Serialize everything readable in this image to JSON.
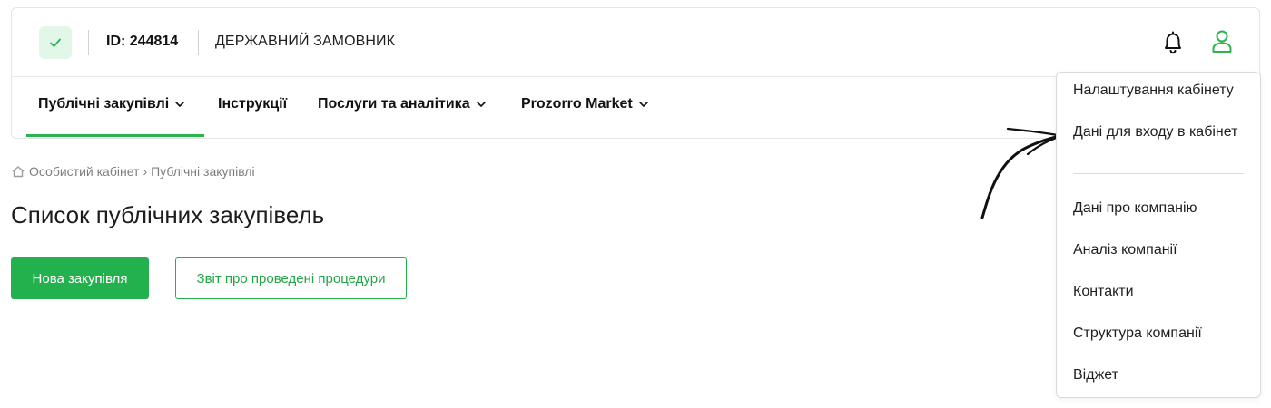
{
  "header": {
    "id_label": "ID: 244814",
    "role": "ДЕРЖАВНИЙ ЗАМОВНИК",
    "icons": {
      "status": "check-icon",
      "notifications": "bell-icon",
      "profile": "user-icon"
    }
  },
  "nav": {
    "items": [
      {
        "label": "Публічні закупівлі",
        "has_dropdown": true,
        "active": true
      },
      {
        "label": "Інструкції",
        "has_dropdown": false,
        "active": false
      },
      {
        "label": "Послуги та аналітика",
        "has_dropdown": true,
        "active": false
      },
      {
        "label": "Prozorro Market",
        "has_dropdown": true,
        "active": false
      }
    ]
  },
  "breadcrumb": {
    "home": "Особистий кабінет",
    "separator": "›",
    "current": "Публічні закупівлі"
  },
  "page": {
    "title": "Список публічних закупівель",
    "primary_button": "Нова закупівля",
    "secondary_button": "Звіт про проведені процедури"
  },
  "profile_menu": {
    "items": [
      "Налаштування кабінету",
      "Дані для входу в кабінет",
      "Дані про компанію",
      "Аналіз компанії",
      "Контакти",
      "Структура компанії",
      "Віджет"
    ]
  },
  "colors": {
    "accent": "#23b14d",
    "accent_light": "#e3f7e9",
    "text": "#1f1f1f",
    "muted": "#7b7f83",
    "border": "#e4e6e8"
  }
}
